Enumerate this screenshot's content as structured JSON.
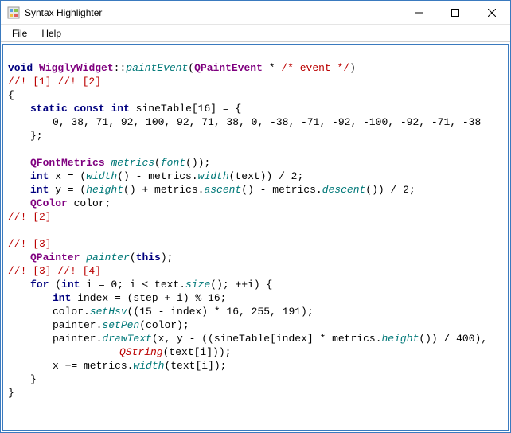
{
  "window": {
    "title": "Syntax Highlighter"
  },
  "menu": {
    "file": "File",
    "help": "Help"
  },
  "code": {
    "kw_void": "void",
    "cls_wiggly": "WigglyWidget",
    "sep_dcol": "::",
    "fn_paintEvent": "paintEvent",
    "lp": "(",
    "rp": ")",
    "cls_qpaintevent": "QPaintEvent",
    "star_sp": " * ",
    "cm_event": "/* event */",
    "ann12": "//! [1] //! [2]",
    "lb": "{",
    "rb": "}",
    "kw_static": "static",
    "kw_const": "const",
    "kw_int": "int",
    "sineDecl": " sineTable[16] = {",
    "sineVals": "0, 38, 71, 92, 100, 92, 71, 38, 0, -38, -71, -92, -100, -92, -71, -38",
    "rb_sc": "};",
    "cls_qfm": "QFontMetrics",
    "sp": " ",
    "fn_metrics": "metrics",
    "fn_font": "font",
    "call_close": "());",
    "x_eq": " x = (",
    "fn_width": "width",
    "minus_metrics": "() - metrics.",
    "txt_close_div2": "(text)) / 2;",
    "y_eq": " y = (",
    "fn_height": "height",
    "plus_metrics": "() + metrics.",
    "fn_ascent": "ascent",
    "minus_metrics2": "() - metrics.",
    "fn_descent": "descent",
    "close_div2b": "()) / 2;",
    "cls_qcolor": "QColor",
    "color_sc": " color;",
    "ann2c": "//! [2]",
    "ann3": "//! [3]",
    "cls_qpainter": "QPainter",
    "fn_painter": "painter",
    "kw_this": "this",
    "rparen_sc": ");",
    "ann34": "//! [3] //! [4]",
    "kw_for": "for",
    "for_open": " (",
    "for_init": " i = 0; i < text.",
    "fn_size": "size",
    "for_tail": "(); ++i) {",
    "idx_decl": " index = (step + i) % 16;",
    "color_dot": "color.",
    "fn_setHsv": "setHsv",
    "setHsv_args": "((15 - index) * 16, 255, 191);",
    "painter_dot": "painter.",
    "fn_setPen": "setPen",
    "setPen_args": "(color);",
    "fn_drawText": "drawText",
    "drawText_a": "(x, y - ((sineTable[index] * metrics.",
    "drawText_b": "()) / 400),",
    "cls_qstring": "QString",
    "qstring_args": "(text[i]));",
    "xpe": "x += metrics.",
    "width_texti": "(text[i]);"
  }
}
